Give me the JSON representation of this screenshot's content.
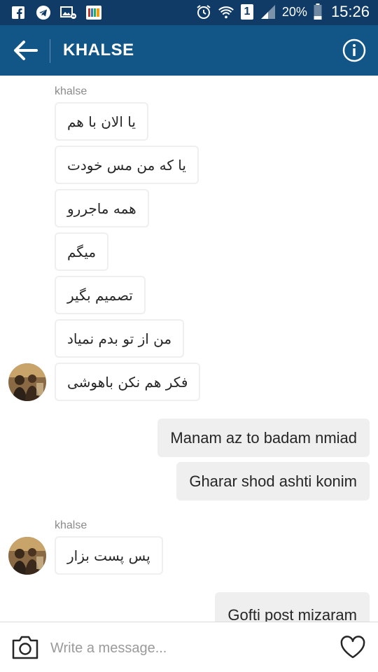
{
  "status_bar": {
    "icons_left": [
      "facebook-icon",
      "telegram-icon",
      "image-notification-icon",
      "bookshelf-icon"
    ],
    "icons_right": [
      "alarm-icon",
      "wifi-icon",
      "sim1-icon",
      "signal-icon",
      "battery-icon"
    ],
    "sim_label": "1",
    "battery": "20%",
    "time": "15:26"
  },
  "header": {
    "title": "KHALSE",
    "back_icon": "arrow-left-icon",
    "info_icon": "info-icon",
    "bar_color": "#125688"
  },
  "messages": {
    "group1": {
      "sender": "khalse",
      "bubbles": [
        "یا الان با هم",
        "یا که من مس خودت",
        "همه ماجررو",
        "میگم",
        "تصمیم بگیر",
        "من از تو بدم نمیاد",
        "فکر هم نکن باهوشی"
      ]
    },
    "outgoing1": [
      "Manam az to badam nmiad",
      "Gharar shod ashti konim"
    ],
    "group2": {
      "sender": "khalse",
      "bubbles": [
        "پس پست بزار"
      ]
    },
    "outgoing2": [
      "Gofti post mizaram"
    ]
  },
  "composer": {
    "placeholder": "Write a message...",
    "camera_icon": "camera-icon",
    "heart_icon": "heart-icon"
  }
}
